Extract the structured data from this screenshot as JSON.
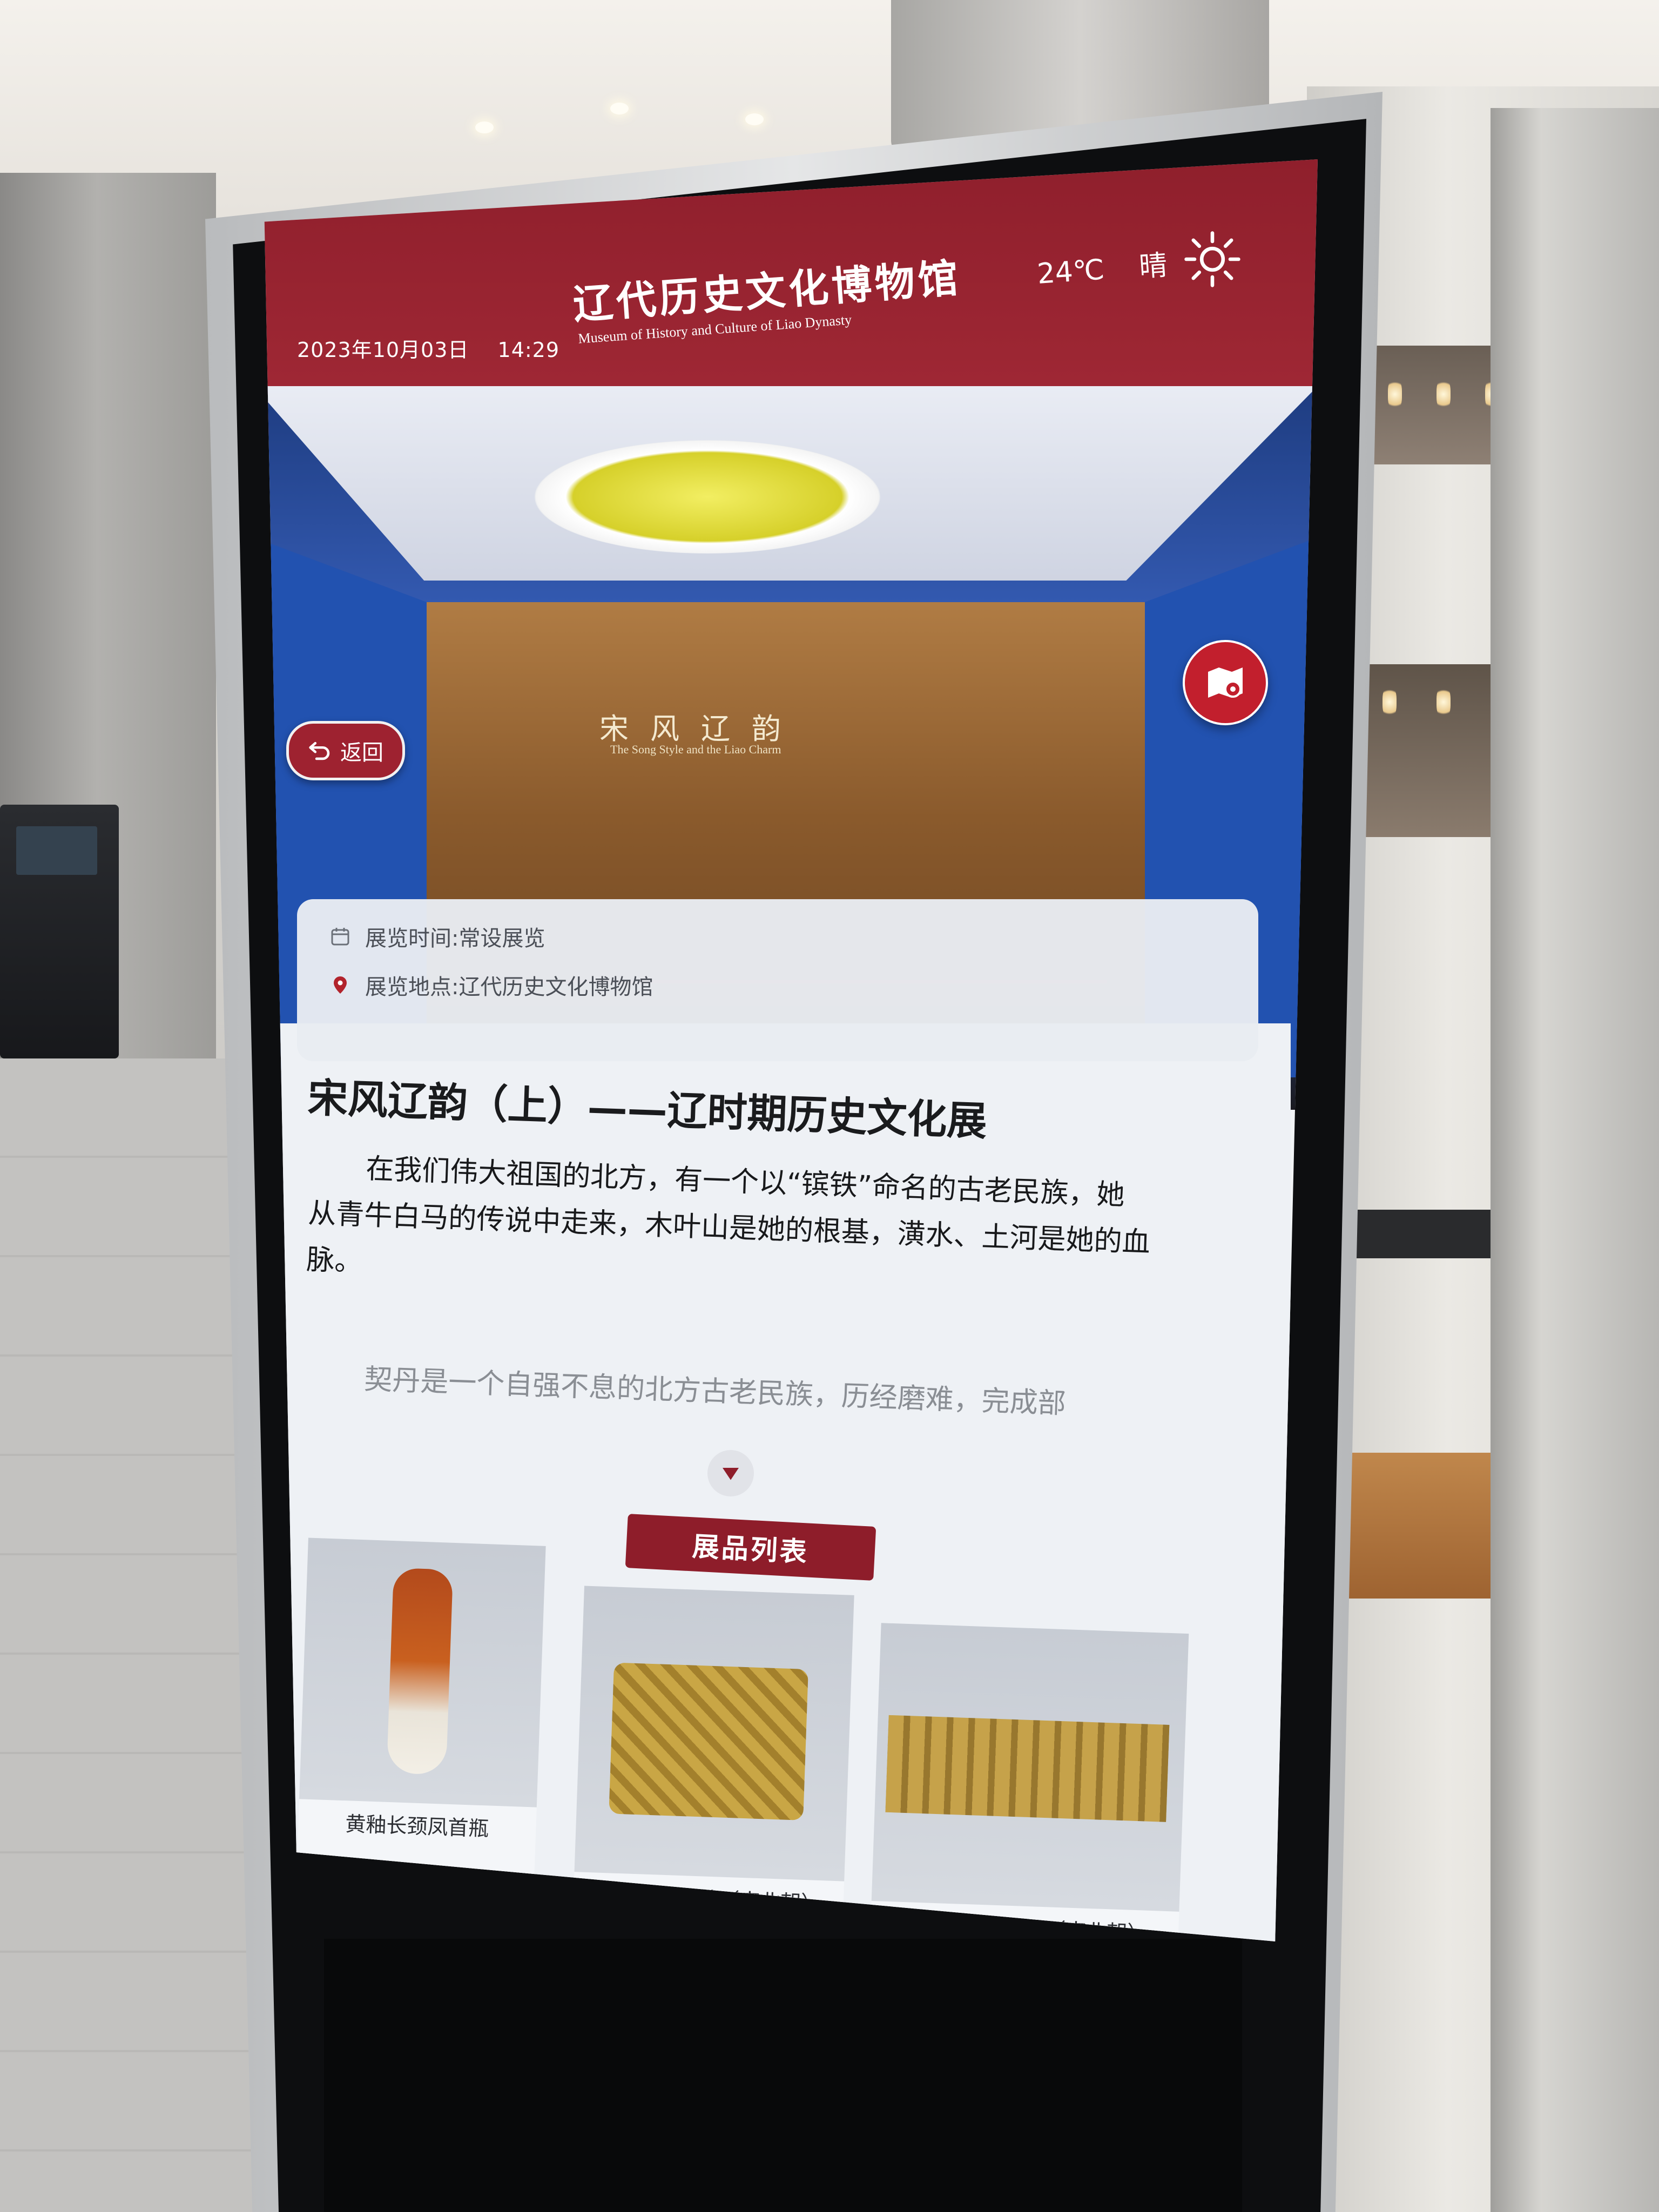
{
  "kiosk": {
    "date": "2023年10月03日",
    "time": "14:29",
    "museum_name": "辽代历史文化博物馆",
    "museum_name_en": "Museum of History and Culture of Liao Dynasty",
    "temperature": "24℃",
    "weather": "晴",
    "weather_icon": "sun-icon"
  },
  "hero": {
    "relief_title": "宋风辽韵",
    "relief_subtitle": "The Song Style and the Liao Charm",
    "back_label": "返回",
    "back_icon": "return-arrow-icon",
    "map_icon": "map-location-icon"
  },
  "info": {
    "time_label": "展览时间:",
    "time_value": "常设展览",
    "time_icon": "calendar-icon",
    "place_label": "展览地点:",
    "place_value": "辽代历史文化博物馆",
    "place_icon": "location-pin-icon"
  },
  "exhibition": {
    "title": "宋风辽韵（上）——辽时期历史文化展",
    "paragraph1": "在我们伟大祖国的北方，有一个以“镔铁”命名的古老民族，她从青牛白马的传说中走来，木叶山是她的根基，潢水、土河是她的血脉。",
    "paragraph2": "契丹是一个自强不息的北方古老民族，历经磨难，完成部",
    "expand_icon": "chevron-down-icon"
  },
  "list": {
    "heading": "展品列表",
    "items": [
      {
        "caption": "黄釉长颈凤首瓶"
      },
      {
        "caption": "千角鹿纹金牌（南北朝）"
      },
      {
        "caption": "瑞兽联珠纹金牌（南北朝）"
      }
    ]
  },
  "colors": {
    "header_red": "#a22936",
    "button_red": "#c21f2d",
    "wall_blue": "#2252b0"
  }
}
